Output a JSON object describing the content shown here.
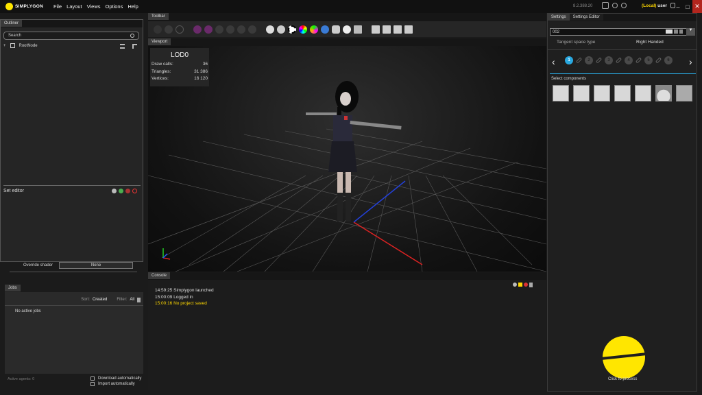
{
  "app": {
    "name": "SIMPLYGON",
    "version": "8.2.388.20",
    "user_local": "(Local)",
    "user_name": "user"
  },
  "menu": [
    "File",
    "Layout",
    "Views",
    "Options",
    "Help"
  ],
  "outliner": {
    "tab": "Outliner",
    "search_placeholder": "Search",
    "root": "RootNode",
    "set_editor": "Set editor",
    "override_label": "Override shader",
    "override_value": "None"
  },
  "jobs": {
    "tab": "Jobs",
    "sort_label": "Sort:",
    "sort_value": "Created",
    "filter_label": "Filter:",
    "filter_value": "All",
    "empty": "No active jobs",
    "agents": "Active agents: 0",
    "download_auto": "Download automatically",
    "import_auto": "Import automatically"
  },
  "toolbar": {
    "tab": "Toolbar"
  },
  "viewport": {
    "tab": "Viewport",
    "lod": "LOD0",
    "stats": [
      {
        "label": "Draw calls:",
        "value": "36"
      },
      {
        "label": "Triangles:",
        "value": "31 386"
      },
      {
        "label": "Vertices:",
        "value": "16 120"
      }
    ]
  },
  "console": {
    "tab": "Console",
    "lines": [
      {
        "text": "14:59:25 Simplygon launched",
        "color": "#dddddd"
      },
      {
        "text": "15:00:09 Logged in",
        "color": "#dddddd"
      },
      {
        "text": "15:00:16 No project saved",
        "color": "#ffd800"
      }
    ]
  },
  "settings": {
    "tab_settings": "Settings",
    "tab_editor": "Settings Editor",
    "preset": "002",
    "tangent_label": "Tangent space type",
    "tangent_value": "Right Handed",
    "steps": [
      "1",
      "2",
      "3",
      "4",
      "5",
      "6"
    ],
    "select_components": "Select components",
    "process": "Click to process"
  },
  "colors": {
    "accent": "#29a8e0",
    "brand": "#ffe600",
    "warning": "#ffd800"
  }
}
